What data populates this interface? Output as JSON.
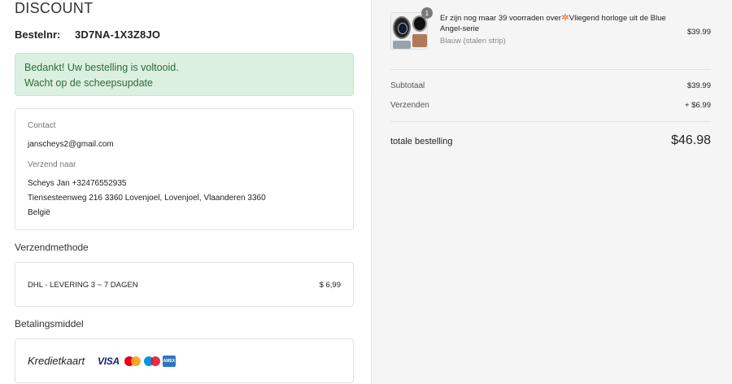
{
  "brand": "DISCOUNT",
  "order": {
    "label": "Bestelnr:",
    "number": "3D7NA-1X3Z8JO"
  },
  "success": {
    "line1": "Bedankt! Uw bestelling is voltooid.",
    "line2": "Wacht op de scheepsupdate"
  },
  "contact": {
    "label": "Contact",
    "email": "janscheys2@gmail.com",
    "ship_label": "Verzend naar",
    "name_phone": "Scheys Jan  +32476552935",
    "address": "Tiensesteenweg 216 3360 Lovenjoel, Lovenjoel, Vlaanderen 3360",
    "country": "België"
  },
  "shipping": {
    "title": "Verzendmethode",
    "method": "DHL - LEVERING 3 ~ 7 DAGEN",
    "price": "$ 6,99"
  },
  "payment": {
    "title": "Betalingsmiddel",
    "method": "Kredietkaart",
    "cards": [
      "VISA",
      "MasterCard",
      "Maestro",
      "American Express"
    ],
    "visa_text": "VISA",
    "amex_text": "AMEX"
  },
  "product": {
    "quantity": "1",
    "title_part1": "Er zijn nog maar 39 voorraden over",
    "title_part2": "Vliegend horloge uit de Blue Angel-serie",
    "variant": "Blauw (stalen strip)",
    "price": "$39.99",
    "icon": "collision-emoji-icon"
  },
  "summary": {
    "subtotal_label": "Subtotaal",
    "subtotal_value": "$39.99",
    "shipping_label": "Verzenden",
    "shipping_value": "+ $6.99",
    "total_label": "totale bestelling",
    "total_value": "$46.98"
  }
}
